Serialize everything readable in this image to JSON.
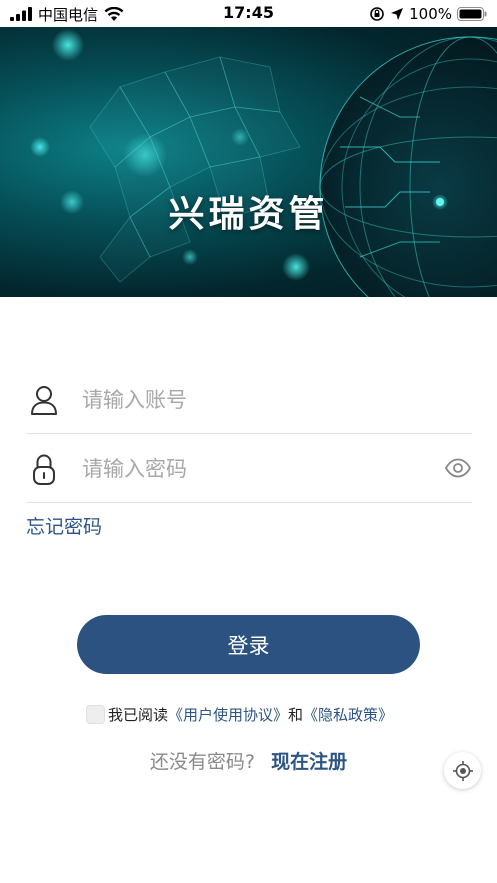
{
  "status_bar": {
    "carrier": "中国电信",
    "time": "17:45",
    "battery": "100%"
  },
  "banner": {
    "title": "兴瑞资管"
  },
  "login_form": {
    "account_placeholder": "请输入账号",
    "password_placeholder": "请输入密码",
    "forgot_label": "忘记密码",
    "login_label": "登录"
  },
  "agreement": {
    "prefix": "我已阅读",
    "user_agreement": "《用户使用协议》",
    "and": "和",
    "privacy_policy": "《隐私政策》",
    "checked": false
  },
  "register": {
    "question": "还没有密码?",
    "link": "现在注册"
  },
  "icons": {
    "signal": "signal-icon",
    "wifi": "wifi-icon",
    "rotation_lock": "rotation-lock-icon",
    "location": "location-arrow-icon",
    "battery": "battery-icon",
    "user": "user-icon",
    "lock": "lock-icon",
    "eye": "eye-icon",
    "locate": "locate-icon"
  },
  "colors": {
    "primary": "#2c5282",
    "link": "#2c5585",
    "placeholder": "#a8a8a8"
  }
}
